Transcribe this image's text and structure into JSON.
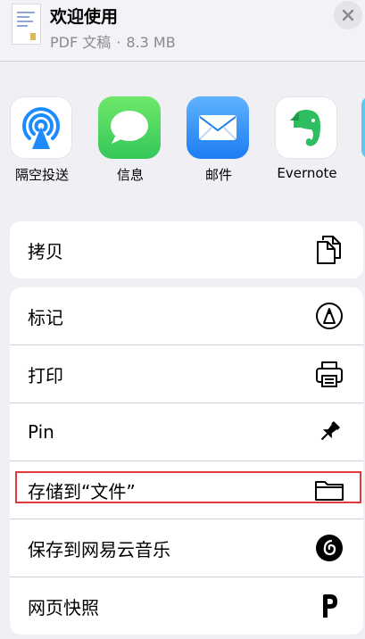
{
  "header": {
    "title": "欢迎使用",
    "file_type": "PDF 文稿",
    "separator": "·",
    "file_size": "8.3 MB"
  },
  "apps": [
    {
      "label": "隔空投送",
      "icon": "airdrop-icon"
    },
    {
      "label": "信息",
      "icon": "messages-icon"
    },
    {
      "label": "邮件",
      "icon": "mail-icon"
    },
    {
      "label": "Evernote",
      "icon": "evernote-icon"
    }
  ],
  "actions_group1": [
    {
      "label": "拷贝",
      "icon": "copy-icon"
    }
  ],
  "actions_group2": [
    {
      "label": "标记",
      "icon": "markup-icon"
    },
    {
      "label": "打印",
      "icon": "printer-icon"
    },
    {
      "label": "Pin",
      "icon": "pin-icon"
    },
    {
      "label": "存储到“文件”",
      "icon": "folder-icon"
    },
    {
      "label": "保存到网易云音乐",
      "icon": "netease-music-icon"
    },
    {
      "label": "网页快照",
      "icon": "pinterest-p-icon"
    }
  ],
  "colors": {
    "background": "#efeff4",
    "highlight": "#e0393e",
    "messages": "#34c759",
    "mail": "#1c7cf2",
    "airdrop": "#1a8cff",
    "evernote": "#2dbe60"
  }
}
